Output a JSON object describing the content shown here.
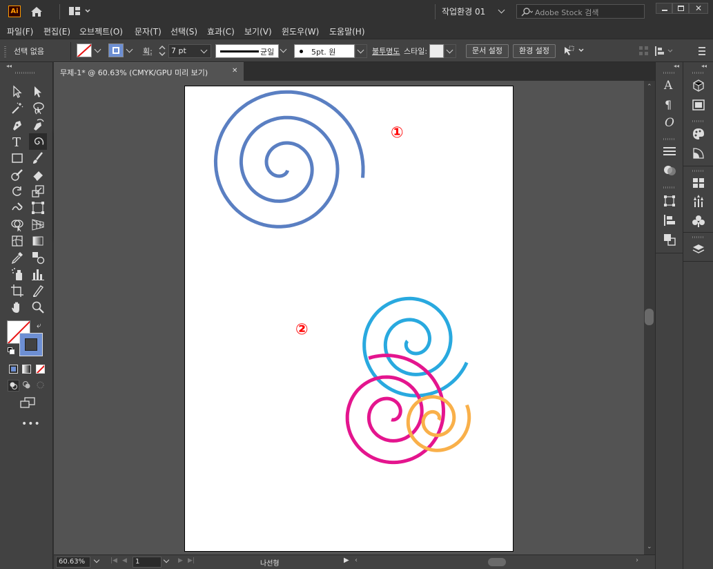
{
  "app": {
    "logo": "Ai"
  },
  "titlebar": {
    "workspace": "작업환경 01",
    "search_placeholder": "Adobe Stock 검색",
    "home_icon": "home-icon",
    "arrange_icon": "arrange-documents-icon"
  },
  "menu": {
    "items": [
      "파일(F)",
      "편집(E)",
      "오브젝트(O)",
      "문자(T)",
      "선택(S)",
      "효과(C)",
      "보기(V)",
      "윈도우(W)",
      "도움말(H)"
    ]
  },
  "control": {
    "selection_label": "선택 없음",
    "stroke_label": "획:",
    "stroke_weight": "7 pt",
    "stroke_profile": "균일",
    "brush": "5pt. 원",
    "opacity_label": "불투명도",
    "style_label": "스타일:",
    "doc_setup": "문서 설정",
    "preferences": "환경 설정"
  },
  "document": {
    "tab_title": "무제-1* @ 60.63% (CMYK/GPU 미리 보기)",
    "zoom": "60.63%",
    "artboard_number": "1",
    "status_tool": "나선형"
  },
  "annotations": {
    "marker_1": "①",
    "marker_2": "②"
  },
  "colors": {
    "spiral_1": "#5a7fc2",
    "spiral_cyan": "#29a9df",
    "spiral_magenta": "#e4158e",
    "spiral_orange": "#f9b04a",
    "marker": "#ff0000",
    "fill_swatch": "#6d8fd3"
  }
}
